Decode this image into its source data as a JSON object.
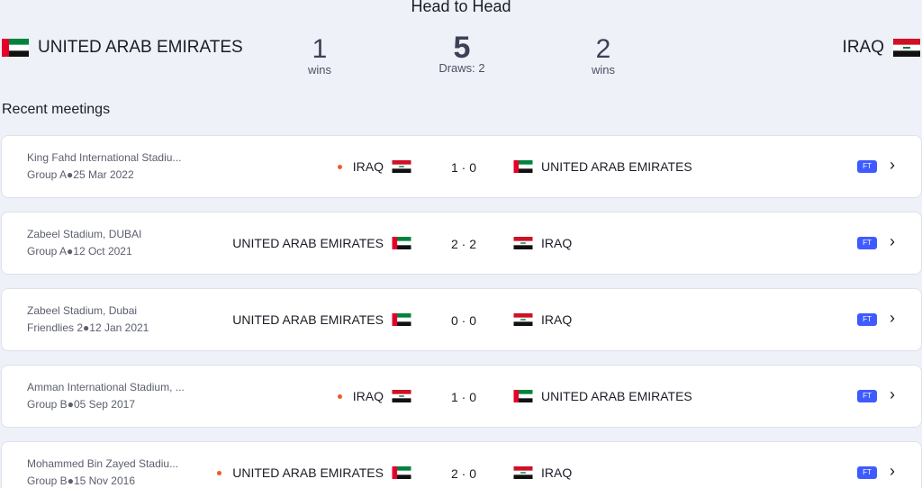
{
  "header": {
    "title": "Head to Head"
  },
  "home_team": {
    "name": "UNITED ARAB EMIRATES",
    "flag": "uae-flag"
  },
  "away_team": {
    "name": "IRAQ",
    "flag": "iraq-flag"
  },
  "summary": {
    "home_wins": "1",
    "home_wins_label": "wins",
    "total": "5",
    "draws_label": "Draws: 2",
    "away_wins": "2",
    "away_wins_label": "wins"
  },
  "recent_label": "Recent meetings",
  "matches": [
    {
      "venue": "King Fahd International Stadiu...",
      "group": "Group A●25 Mar 2022",
      "home": "IRAQ",
      "score": "1 · 0",
      "away": "UNITED ARAB EMIRATES",
      "status": "FT"
    },
    {
      "venue": "Zabeel Stadium, DUBAI",
      "group": "Group A●12 Oct 2021",
      "home": "UNITED ARAB EMIRATES",
      "score": "2 · 2",
      "away": "IRAQ",
      "status": "FT"
    },
    {
      "venue": "Zabeel Stadium, Dubai",
      "group": "Friendlies 2●12 Jan 2021",
      "home": "UNITED ARAB EMIRATES",
      "score": "0 · 0",
      "away": "IRAQ",
      "status": "FT"
    },
    {
      "venue": "Amman International Stadium, ...",
      "group": "Group B●05 Sep 2017",
      "home": "IRAQ",
      "score": "1 · 0",
      "away": "UNITED ARAB EMIRATES",
      "status": "FT"
    },
    {
      "venue": "Mohammed Bin Zayed Stadiu...",
      "group": "Group B●15 Nov 2016",
      "home": "UNITED ARAB EMIRATES",
      "score": "2 · 0",
      "away": "IRAQ",
      "status": "FT"
    }
  ],
  "colors": {
    "ft_badge": "#3f5bff",
    "winner_dot": "#f05a28",
    "background": "#eef1f8"
  }
}
